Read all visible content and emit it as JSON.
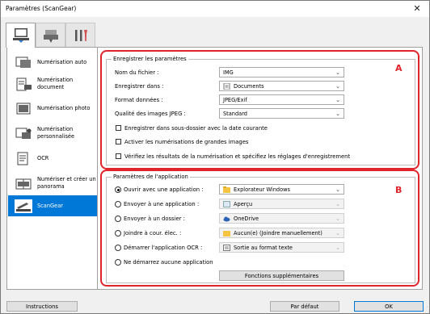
{
  "window": {
    "title": "Paramètres (ScanGear)",
    "close_glyph": "✕"
  },
  "top_tabs": [
    {
      "icon": "scan-from-computer-icon"
    },
    {
      "icon": "scan-from-operation-panel-icon"
    },
    {
      "icon": "general-settings-tools-icon"
    }
  ],
  "sidebar": {
    "items": [
      {
        "label": "Numérisation auto",
        "icon": "auto-scan-icon"
      },
      {
        "label": "Numérisation document",
        "icon": "document-scan-icon"
      },
      {
        "label": "Numérisation photo",
        "icon": "photo-scan-icon"
      },
      {
        "label": "Numérisation personnalisée",
        "icon": "custom-scan-icon"
      },
      {
        "label": "OCR",
        "icon": "ocr-icon"
      },
      {
        "label": "Numériser et créer un panorama",
        "icon": "panorama-icon"
      },
      {
        "label": "ScanGear",
        "icon": "scangear-icon",
        "selected": true
      }
    ]
  },
  "save_settings": {
    "title": "Enregistrer les paramètres",
    "file_name_label": "Nom du fichier :",
    "file_name_value": "IMG",
    "save_in_label": "Enregistrer dans :",
    "save_in_value": "Documents",
    "data_format_label": "Format données :",
    "data_format_value": "JPEG/Exif",
    "jpeg_quality_label": "Qualité des images JPEG :",
    "jpeg_quality_value": "Standard",
    "checkbox_subfolder": "Enregistrer dans sous-dossier avec la date courante",
    "checkbox_large_numbers": "Activer les numérisations de grandes images",
    "checkbox_verify": "Vérifiez les résultats de la numérisation et spécifiez les réglages d'enregistrement"
  },
  "app_settings": {
    "title": "Paramètres de l'application",
    "open_app_label": "Ouvrir avec une application :",
    "open_app_value": "Explorateur Windows",
    "send_app_label": "Envoyer à une application :",
    "send_app_value": "Aperçu",
    "send_folder_label": "Envoyer à un dossier :",
    "send_folder_value": "OneDrive",
    "email_label": "Joindre à cour. élec. :",
    "email_value": "Aucun(e) (Joindre manuellement)",
    "ocr_label": "Démarrer l'application OCR :",
    "ocr_value": "Sortie au format texte",
    "no_app_label": "Ne démarrez aucune application",
    "more_functions": "Fonctions supplémentaires",
    "selected_option": "open_app"
  },
  "annotations": {
    "box_a": "A",
    "box_b": "B"
  },
  "buttons": {
    "instructions": "Instructions",
    "defaults": "Par défaut",
    "ok": "OK"
  },
  "colors": {
    "annotation_red": "#e0242b",
    "selection_blue": "#0078d7"
  }
}
